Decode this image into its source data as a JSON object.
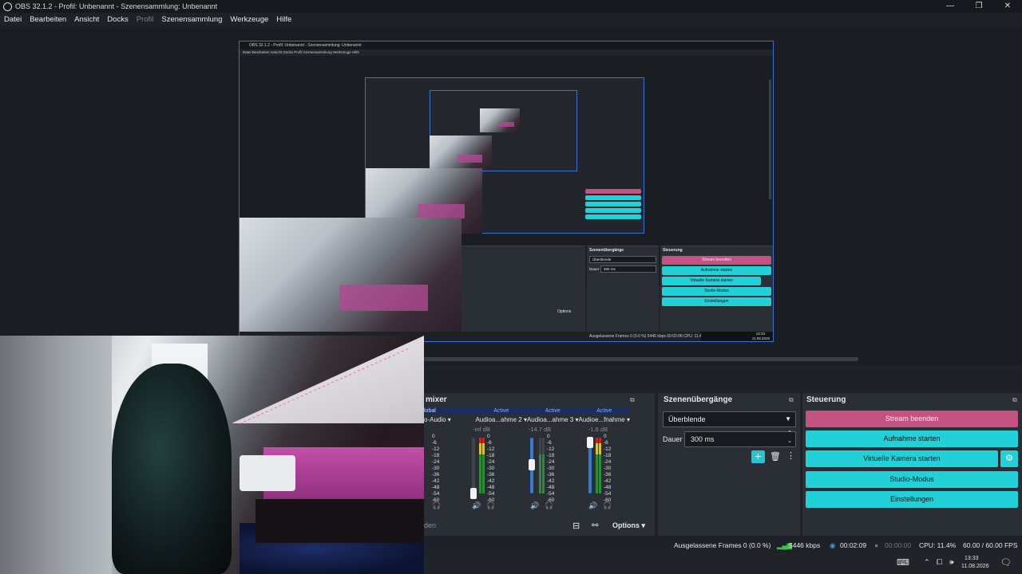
{
  "window": {
    "title": "OBS 32.1.2 - Profil: Unbenannt - Szenensammlung: Unbenannt",
    "controls": {
      "minimize": "—",
      "maximize": "❐",
      "close": "✕"
    }
  },
  "menu": [
    {
      "label": "Datei"
    },
    {
      "label": "Bearbeiten"
    },
    {
      "label": "Ansicht"
    },
    {
      "label": "Docks"
    },
    {
      "label": "Profil"
    },
    {
      "label": "Szenensammlung"
    },
    {
      "label": "Werkzeuge"
    },
    {
      "label": "Hilfe"
    }
  ],
  "nested": {
    "title": "OBS 32.1.2 - Profil: Unbenannt - Szenensammlung: Unbenannt",
    "menu": "Datei   Bearbeiten   Ansicht   Docks   Profil   Szenensammlung   Werkzeuge   Hilfe",
    "controls_label": "Steuerung",
    "transitions_label": "Szenenübergänge",
    "buttons": [
      "Stream beenden",
      "Aufnahme starten",
      "Virtuelle Kamera starten",
      "Studio-Modus",
      "Einstellungen"
    ],
    "transition_value": "Überblende",
    "duration": "300 ms",
    "duration_label": "Dauer",
    "status": "Ausgelassene Frames 0 (0.0 %)   5446 kbps   00:02:06   CPU: 11.4%   60.00 / 60.00 FPS",
    "options": "Options",
    "mixer_tabs": [
      "Global",
      "Active",
      "Active",
      "Active"
    ],
    "mixer_names": [
      "Audio",
      "Audioa...ahme 2",
      "Audioa...ahme 3",
      "Audioe...fnahme"
    ],
    "clock": "13:33",
    "date": "11.08.2026"
  },
  "mixer": {
    "title": "Audiomixer",
    "title_visible": "mixer",
    "tabs": [
      "Global",
      "Active",
      "Active",
      "Active"
    ],
    "tab_visible_first": "lobal",
    "channels": [
      {
        "name": "o-Audio",
        "db": ""
      },
      {
        "name": "Audioa...ahme 2",
        "db": "-inf dB",
        "level": 0.0
      },
      {
        "name": "Audioa...ahme 3",
        "db": "-14.7 dB",
        "level": 0.62
      },
      {
        "name": "Audioe...fnahme",
        "db": "-1.6 dB",
        "level": 0.97
      }
    ],
    "ticks": [
      "0",
      "-6",
      "-12",
      "-18",
      "-24",
      "-30",
      "-36",
      "-42",
      "-48",
      "-54",
      "-60"
    ],
    "footer_left": "den",
    "options_label": "Options"
  },
  "transitions": {
    "title": "Szenenübergänge",
    "selected": "Überblende",
    "duration_label": "Dauer",
    "duration": "300 ms"
  },
  "controls": {
    "title": "Steuerung",
    "stream": "Stream beenden",
    "record": "Aufnahme starten",
    "vcam": "Virtuelle Kamera starten",
    "studio": "Studio-Modus",
    "settings": "Einstellungen"
  },
  "status": {
    "dropped": "Ausgelassene Frames 0 (0.0 %)",
    "bitrate": "5446 kbps",
    "stream_time": "00:02:09",
    "rec_time": "00:00:00",
    "cpu": "CPU: 11.4%",
    "fps": "60.00 / 60.00 FPS"
  },
  "taskbar": {
    "time": "13:33",
    "date": "11.08.2026"
  },
  "colors": {
    "accent": "#22d0d8",
    "live": "#c45283",
    "panel": "#2a2e35",
    "background": "#1e2228"
  }
}
